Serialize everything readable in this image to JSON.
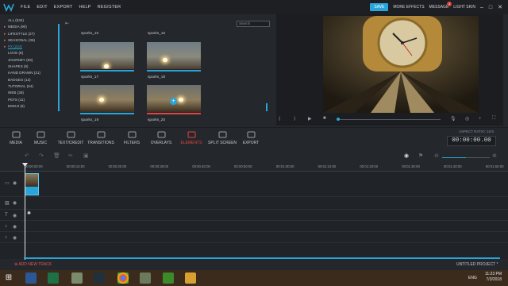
{
  "menubar": {
    "items": [
      "FILE",
      "EDIT",
      "EXPORT",
      "HELP",
      "REGISTER"
    ],
    "save": "SAVE",
    "more_effects": "MORE EFFECTS",
    "message": "MESSAGE",
    "message_count": "1",
    "light_skin": "LIGHT SKIN"
  },
  "sidebar": {
    "categories": [
      {
        "label": "ALL (534)",
        "arrow": false,
        "active": false
      },
      {
        "label": "MEDIA (90)",
        "arrow": true,
        "active": false
      },
      {
        "label": "LIFESTYLE (27)",
        "arrow": true,
        "active": false
      },
      {
        "label": "SEASONAL (36)",
        "arrow": true,
        "active": false
      },
      {
        "label": "FX (224)",
        "arrow": true,
        "active": true
      },
      {
        "label": "LOVE (8)",
        "arrow": false,
        "active": false
      },
      {
        "label": "JOURNEY (66)",
        "arrow": false,
        "active": false
      },
      {
        "label": "SHAPES (6)",
        "arrow": false,
        "active": false
      },
      {
        "label": "HAND DRAWN (21)",
        "arrow": false,
        "active": false
      },
      {
        "label": "BADGES (12)",
        "arrow": false,
        "active": false
      },
      {
        "label": "TUTORIAL (64)",
        "arrow": false,
        "active": false
      },
      {
        "label": "WEB (36)",
        "arrow": false,
        "active": false
      },
      {
        "label": "PETS (11)",
        "arrow": false,
        "active": false
      },
      {
        "label": "EMOJI (9)",
        "arrow": false,
        "active": false
      }
    ]
  },
  "library": {
    "search_placeholder": "Search",
    "thumbs": [
      {
        "label": "sparks_15"
      },
      {
        "label": "sparks_16"
      },
      {
        "label": "sparks_17"
      },
      {
        "label": "sparks_18"
      },
      {
        "label": "sparks_19"
      },
      {
        "label": "sparks_20"
      }
    ]
  },
  "toolbar": {
    "tools": [
      "MEDIA",
      "MUSIC",
      "TEXT/CREDIT",
      "TRANSITIONS",
      "FILTERS",
      "OVERLAYS",
      "ELEMENTS",
      "SPLIT SCREEN",
      "EXPORT"
    ],
    "active": "ELEMENTS",
    "aspect_ratio": "ASPECT RATIO: 16:9",
    "timecode": "00:00:00.00"
  },
  "timeline": {
    "ruler": [
      "00:00:00:00",
      "00:00:10:00",
      "00:00:20:00",
      "00:00:30:00",
      "00:00:40:00",
      "00:00:50:00",
      "00:01:00:00",
      "00:01:10:00",
      "00:01:20:00",
      "00:01:30:00",
      "00:01:40:00",
      "00:01:50:00"
    ],
    "add_new_track": "ADD NEW TRACK",
    "project_name": "UNTITLED PROJECT *"
  },
  "taskbar": {
    "lang": "ENG",
    "time": "11:23 PM",
    "date": "7/3/2018"
  },
  "colors": {
    "accent": "#2aa5d9",
    "alert": "#e0443c",
    "background": "#24272c"
  }
}
